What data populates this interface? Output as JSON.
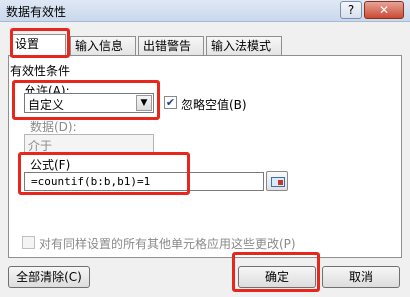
{
  "window": {
    "title": "数据有效性",
    "help_label": "?",
    "close_label": "✕"
  },
  "tabs": [
    {
      "label": "设置",
      "active": true
    },
    {
      "label": "输入信息",
      "active": false
    },
    {
      "label": "出错警告",
      "active": false
    },
    {
      "label": "输入法模式",
      "active": false
    }
  ],
  "settings": {
    "group_title": "有效性条件",
    "allow_label": "允许(A):",
    "allow_value": "自定义",
    "ignore_blank_label": "忽略空值(B)",
    "ignore_blank_checked": true,
    "data_label": "数据(D):",
    "data_value": "介于",
    "formula_label": "公式(F)",
    "formula_value": "=countif(b:b,b1)=1",
    "apply_all_label": "对有同样设置的所有其他单元格应用这些更改(P)",
    "apply_all_checked": false
  },
  "buttons": {
    "clear_all": "全部清除(C)",
    "ok": "确定",
    "cancel": "取消"
  },
  "colors": {
    "highlight": "#e8271c"
  }
}
